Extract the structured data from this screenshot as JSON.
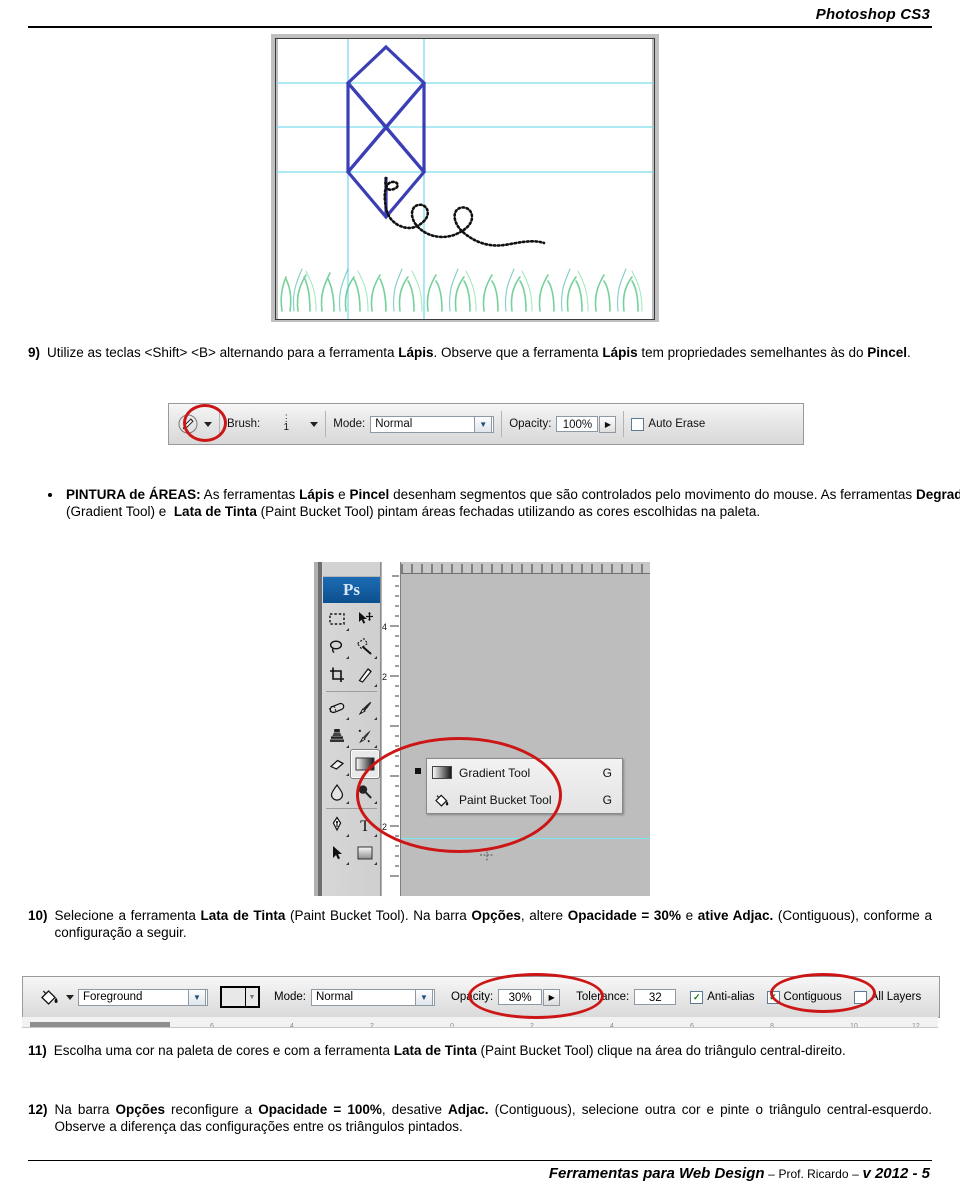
{
  "header": {
    "title": "Photoshop CS3"
  },
  "footer": {
    "course": "Ferramentas para Web Design",
    "dash1": "–",
    "author": "Prof. Ricardo",
    "dash2": "–",
    "version": "v 2012 - 5"
  },
  "figure_kite": {
    "name": "kite-drawing-canvas",
    "description": "Desenho de pipa com linhas azuis, guias ciano, linha pontilhada e grama verde"
  },
  "steps": {
    "s9": {
      "marker": "9)",
      "text_html": "Utilize as teclas &lt;Shift&gt; &lt;B&gt; alternando para a ferramenta <b>Lápis</b>. Observe que a ferramenta <b>Lápis</b> tem propriedades semelhantes às do <b>Pincel</b>."
    },
    "bullet": {
      "text_html": "<b>PINTURA de ÁREAS:</b> As ferramentas <b>Lápis</b> e <b>Pincel</b> desenham segmentos que são controlados pelo movimento do mouse. As ferramentas <b>Degradê</b> (Gradient Tool) e &nbsp;<b>Lata de Tinta</b> (Paint Bucket Tool) pintam áreas fechadas utilizando as cores escolhidas na paleta."
    },
    "s10": {
      "marker": "10)",
      "text_html": "Selecione a ferramenta <b>Lata de Tinta</b> (Paint Bucket Tool). Na barra <b>Opções</b>, altere <b>Opacidade = 30%</b> e <b>ative Adjac.</b> (Contiguous), conforme a configuração a seguir."
    },
    "s11": {
      "marker": "11)",
      "text_html": "Escolha uma cor na paleta de cores e com a ferramenta <b>Lata de Tinta</b> (Paint Bucket Tool) clique na área do triângulo central-direito."
    },
    "s12": {
      "marker": "12)",
      "text_html": "Na barra <b>Opções</b> reconfigure a <b>Opacidade = 100%</b>, desative <b>Adjac.</b> (Contiguous), selecione outra cor e pinte o triângulo central-esquerdo. Observe a diferença das configurações entre os triângulos pintados."
    }
  },
  "pencil_options_bar": {
    "tool_icon": "pencil-icon",
    "brush_label": "Brush:",
    "brush_value": "1",
    "mode_label": "Mode:",
    "mode_value": "Normal",
    "opacity_label": "Opacity:",
    "opacity_value": "100%",
    "auto_erase_label": "Auto Erase",
    "auto_erase_checked": false,
    "highlight_color": "#cc1616"
  },
  "photoshop_toolbar": {
    "logo": "Ps",
    "ruler_marks": [
      "4",
      "2",
      "2"
    ],
    "tools": [
      [
        "marquee-icon",
        "move-icon"
      ],
      [
        "lasso-icon",
        "magic-wand-icon"
      ],
      [
        "crop-icon",
        "slice-icon"
      ],
      [
        "healing-brush-icon",
        "brush-icon"
      ],
      [
        "clone-stamp-icon",
        "history-brush-icon"
      ],
      [
        "eraser-icon",
        "gradient-icon"
      ],
      [
        "blur-icon",
        "dodge-icon"
      ],
      [
        "pen-icon",
        "type-icon"
      ],
      [
        "path-selection-icon",
        "shape-icon"
      ]
    ],
    "flyout": {
      "items": [
        {
          "icon": "gradient-icon",
          "label": "Gradient Tool",
          "shortcut": "G",
          "selected": true
        },
        {
          "icon": "paint-bucket-icon",
          "label": "Paint Bucket Tool",
          "shortcut": "G",
          "selected": false
        }
      ]
    },
    "highlight_color": "#cc1616"
  },
  "paint_bucket_options_bar": {
    "tool_icon": "paint-bucket-icon",
    "fill_source": "Foreground",
    "pattern_swatch_color": "#e8e8e8",
    "mode_label": "Mode:",
    "mode_value": "Normal",
    "opacity_label": "Opacity:",
    "opacity_value": "30%",
    "tolerance_label": "Tolerance:",
    "tolerance_value": "32",
    "antialias_label": "Anti-alias",
    "antialias_checked": true,
    "contiguous_label": "Contiguous",
    "contiguous_checked": true,
    "all_layers_label": "All Layers",
    "all_layers_checked": false,
    "check_glyph": "✓",
    "highlight_color": "#cc1616"
  }
}
